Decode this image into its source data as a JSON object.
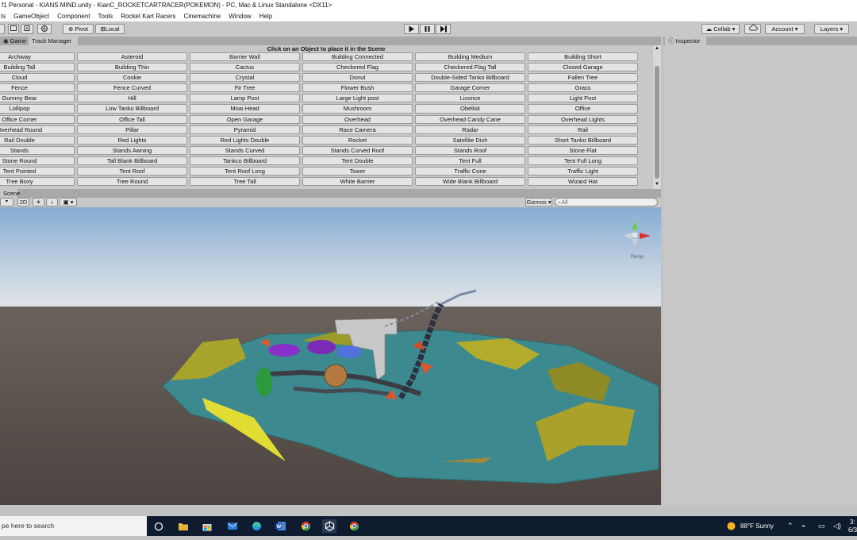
{
  "window": {
    "title": "f1 Personal - KIANS MIND.unity - KianC_ROCKETCARTRACER(POKEMON) - PC, Mac & Linux Standalone <DX11>"
  },
  "menu": [
    "ts",
    "GameObject",
    "Component",
    "Tools",
    "Rocket Kart Racers",
    "Cinemachine",
    "Window",
    "Help"
  ],
  "toolbar": {
    "pivot": "Pivot",
    "local": "Local",
    "collab": "Collab",
    "account": "Account",
    "layers": "Layers"
  },
  "tabs": {
    "game": "Game",
    "track_manager": "Track Manager",
    "inspector": "Inspector",
    "scene": "Scene"
  },
  "track_manager": {
    "header": "Click on an Object to place it in the Scene",
    "items": [
      "Archway",
      "Asteroid",
      "Barrier Wall",
      "Building Connected",
      "Building Medium",
      "Building Short",
      "Building Tall",
      "Building Thin",
      "Cactus",
      "Checkered Flag",
      "Checkered Flag Tall",
      "Closed Garage",
      "Cloud",
      "Cookie",
      "Crystal",
      "Donut",
      "Double-Sided Tanko Billboard",
      "Fallen Tree",
      "Fence",
      "Fence Curved",
      "Fir Tree",
      "Flower Bush",
      "Garage Corner",
      "Grass",
      "Gummy Bear",
      "Hill",
      "Lamp Post",
      "Large Light post",
      "Licorice",
      "Light Post",
      "Lollipop",
      "Low Tanko Billboard",
      "Moai Head",
      "Mushroom",
      "Obelisk",
      "Office",
      "Office Corner",
      "Office Tall",
      "Open Garage",
      "Overhead",
      "Overhead Candy Cane",
      "Overhead Lights",
      "Overhead Round",
      "Pillar",
      "Pyramid",
      "Race Camera",
      "Radar",
      "Rail",
      "Rail Double",
      "Red Lights",
      "Red Lights Double",
      "Rocket",
      "Satellite Dish",
      "Short Tanko Billboard",
      "Stands",
      "Stands Awning",
      "Stands Curved",
      "Stands Curved Roof",
      "Stands Roof",
      "Stone Flat",
      "Stone Round",
      "Tall Blank Billboard",
      "Tankco Billboard",
      "Tent Double",
      "Tent Full",
      "Tent Full Long",
      "Tent Pointed",
      "Tent Roof",
      "Tent Roof Long",
      "Tower",
      "Traffic Cone",
      "Traffic Light",
      "Tree Boxy",
      "Tree Round",
      "Tree Tall",
      "White Barrier",
      "Wide Blank Billboard",
      "Wizard Hat"
    ]
  },
  "scene_toolbar": {
    "mode_2d": "2D",
    "gizmos": "Gizmos",
    "search_placeholder": "All",
    "persp": "Persp"
  },
  "taskbar": {
    "search_placeholder": "pe here to search",
    "weather": "88°F  Sunny",
    "time": "3:",
    "date": "6/3"
  },
  "colors": {
    "editor_bg": "#c8c8c8",
    "sky_top": "#8ab0d8",
    "ground": "#5a4f49",
    "water": "#3c8a8f",
    "taskbar": "#0f1b2e"
  }
}
